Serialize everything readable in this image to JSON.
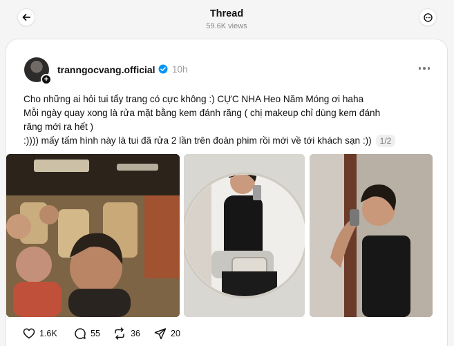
{
  "header": {
    "title": "Thread",
    "views": "59.6K views"
  },
  "post": {
    "username": "tranngocvang.official",
    "time": "10h",
    "lines": [
      "Cho những ai hỏi tui tẩy trang có cực không :) CỰC NHA Heo Năm Móng ơi haha",
      "Mỗi ngày quay xong là rửa mặt bằng kem đánh răng ( chị makeup chỉ dùng kem đánh",
      "răng mới ra hết )",
      ":)))) mấy tấm hình này là tui đã rửa 2 lần trên đoàn phim rồi mới về tới khách sạn :))"
    ],
    "translation_counter": "1/2",
    "photos": [
      "bus-selfie",
      "mirror-selfie-circle",
      "bathroom-selfie"
    ]
  },
  "actions": {
    "likes": "1.6K",
    "replies": "55",
    "reposts": "36",
    "shares": "20"
  },
  "colors": {
    "verified": "#0095f6",
    "page_bg": "#f5f5f5"
  },
  "icons": [
    "back-arrow-icon",
    "more-icon",
    "verified-icon",
    "heart-icon",
    "comment-icon",
    "repost-icon",
    "share-icon"
  ]
}
